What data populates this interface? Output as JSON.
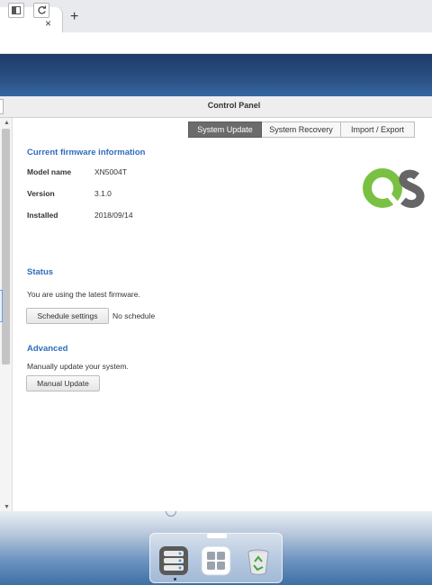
{
  "browser": {
    "tab_close_glyph": "×",
    "new_tab_glyph": "+"
  },
  "window": {
    "title": "Control Panel",
    "toolbar_icons": [
      "panel-toggle-icon",
      "refresh-icon"
    ]
  },
  "tabs": [
    {
      "label": "System Update",
      "active": true
    },
    {
      "label": "System Recovery",
      "active": false
    },
    {
      "label": "Import / Export",
      "active": false
    }
  ],
  "firmware": {
    "section_title": "Current firmware information",
    "rows": [
      {
        "label": "Model name",
        "value": "XN5004T"
      },
      {
        "label": "Version",
        "value": "3.1.0"
      },
      {
        "label": "Installed",
        "value": "2018/09/14"
      }
    ]
  },
  "status": {
    "section_title": "Status",
    "message": "You are using the latest firmware.",
    "schedule_button": "Schedule settings",
    "schedule_value": "No schedule"
  },
  "advanced": {
    "section_title": "Advanced",
    "message": "Manually update your system.",
    "update_button": "Manual Update"
  },
  "logo": {
    "name": "qnap-logo",
    "colors": [
      "#7ac143",
      "#666666"
    ]
  },
  "dock": {
    "items": [
      "storage-manager-icon",
      "app-grid-icon",
      "recycle-bin-icon"
    ]
  },
  "colors": {
    "accent": "#2f6dbd",
    "active_tab": "#6b6b6b"
  }
}
